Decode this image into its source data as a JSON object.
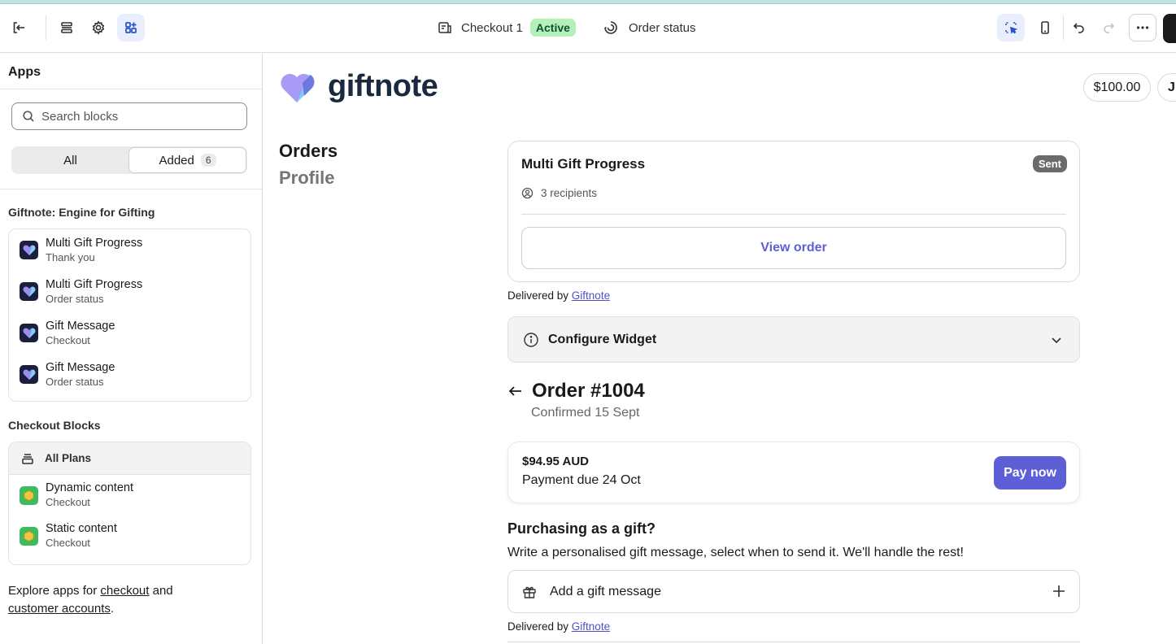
{
  "topbar": {
    "checkout_name": "Checkout 1",
    "status_badge": "Active",
    "page_select": "Order status"
  },
  "sidebar": {
    "title": "Apps",
    "search_placeholder": "Search blocks",
    "tabs": {
      "all": "All",
      "added": "Added",
      "added_count": "6"
    },
    "app_group_title": "Giftnote: Engine for Gifting",
    "app_items": [
      {
        "name": "Multi Gift Progress",
        "target": "Thank you"
      },
      {
        "name": "Multi Gift Progress",
        "target": "Order status"
      },
      {
        "name": "Gift Message",
        "target": "Checkout"
      },
      {
        "name": "Gift Message",
        "target": "Order status"
      }
    ],
    "checkout_group_title": "Checkout Blocks",
    "plans_label": "All Plans",
    "checkout_items": [
      {
        "name": "Dynamic content",
        "target": "Checkout"
      },
      {
        "name": "Static content",
        "target": "Checkout"
      }
    ],
    "explore": {
      "prefix": "Explore apps for ",
      "link1": "checkout",
      "middle": " and",
      "link2": "customer accounts",
      "suffix": "."
    }
  },
  "preview": {
    "logo_text": "giftnote",
    "balance": "$100.00",
    "avatar_initial": "J",
    "nav": {
      "orders": "Orders",
      "profile": "Profile"
    },
    "gift_progress": {
      "title": "Multi Gift Progress",
      "badge": "Sent",
      "recipients": "3 recipients",
      "button": "View order"
    },
    "delivered_prefix": "Delivered by ",
    "delivered_link": "Giftnote",
    "configure_label": "Configure Widget",
    "order": {
      "title": "Order #1004",
      "subtitle": "Confirmed 15 Sept",
      "amount": "$94.95 AUD",
      "due": "Payment due 24 Oct",
      "pay_button": "Pay now"
    },
    "gift": {
      "question": "Purchasing as a gift?",
      "description": "Write a personalised gift message, select when to send it. We'll handle the rest!",
      "add_label": "Add a gift message"
    }
  },
  "colors": {
    "accent": "#5c5fd6",
    "active_badge_bg": "#b4f0b9",
    "sent_badge_bg": "#6b6b6b"
  }
}
